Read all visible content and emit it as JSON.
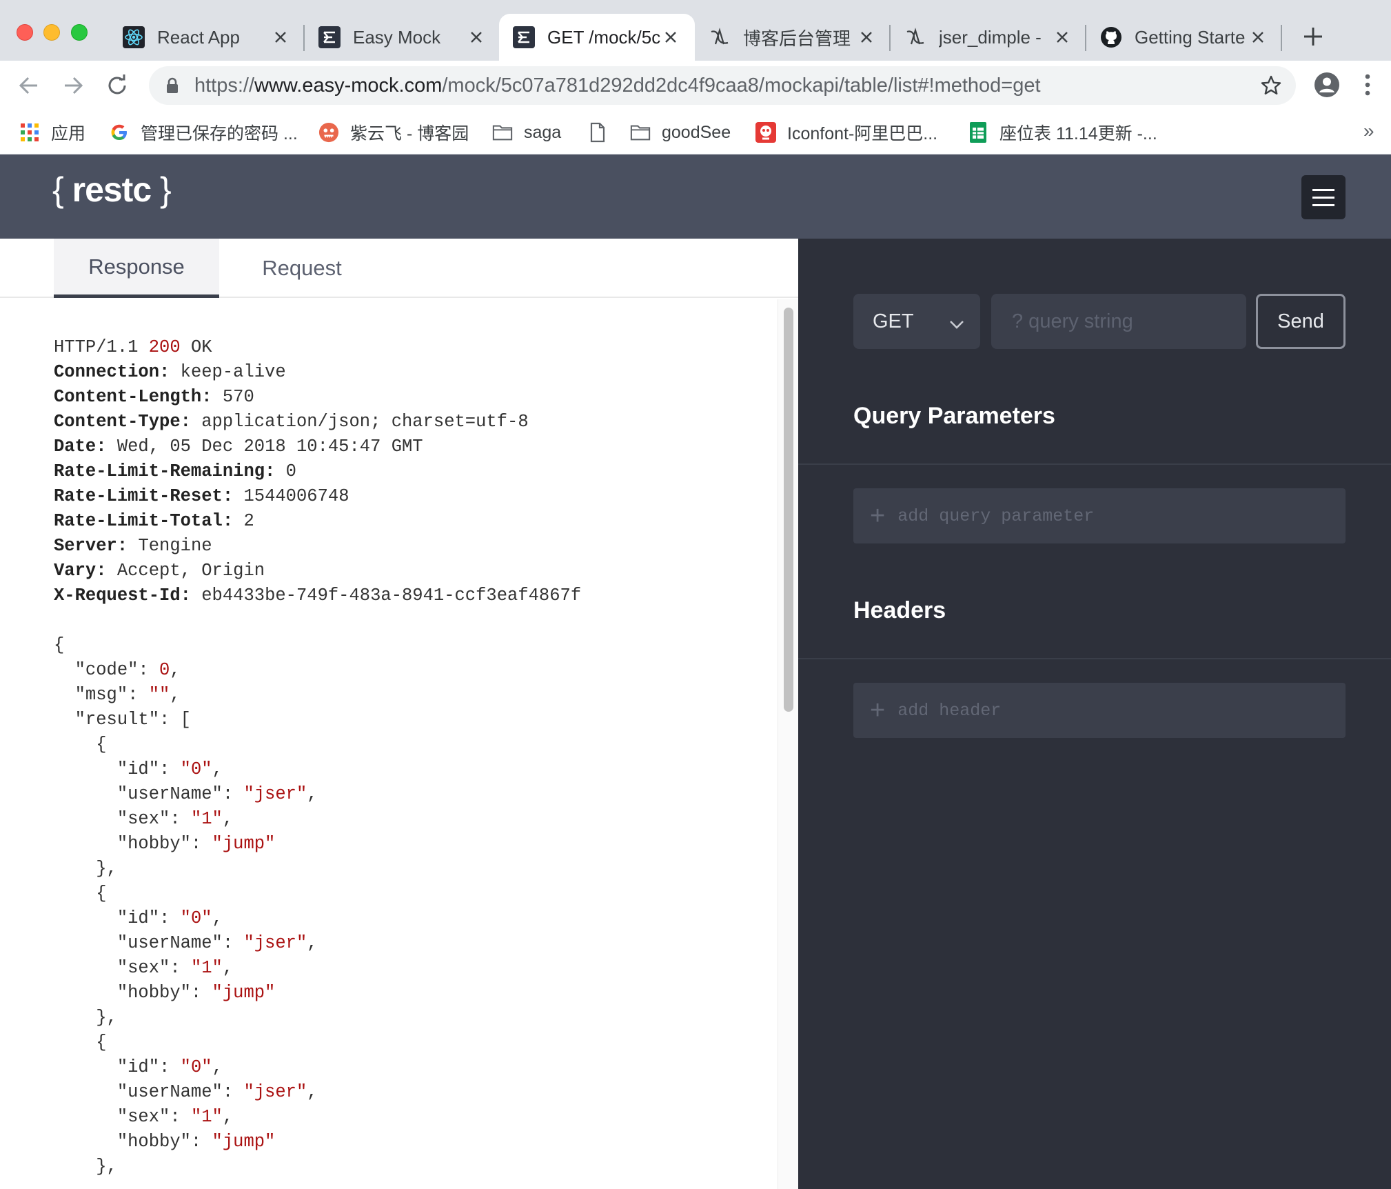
{
  "browser": {
    "tabs": [
      {
        "title": "React App",
        "icon": "react-icon"
      },
      {
        "title": "Easy Mock",
        "icon": "easy-mock-icon"
      },
      {
        "title": "GET /mock/5c",
        "icon": "easy-mock-icon",
        "active": true
      },
      {
        "title": "博客后台管理",
        "icon": "yuque-icon"
      },
      {
        "title": "jser_dimple - ",
        "icon": "yuque-icon"
      },
      {
        "title": "Getting Starte",
        "icon": "github-icon"
      }
    ],
    "url_scheme": "https://",
    "url_host": "www.easy-mock.com",
    "url_path": "/mock/5c07a781d292dd2dc4f9caa8/mockapi/table/list#!method=get",
    "bookmarks": [
      {
        "label": "应用",
        "icon": "apps-grid-icon"
      },
      {
        "label": "管理已保存的密码 ...",
        "icon": "google-icon"
      },
      {
        "label": "紫云飞 - 博客园",
        "icon": "avatar-icon"
      },
      {
        "label": "saga",
        "icon": "folder-icon"
      },
      {
        "label": "",
        "icon": "page-icon"
      },
      {
        "label": "goodSee",
        "icon": "folder-icon"
      },
      {
        "label": "Iconfont-阿里巴巴...",
        "icon": "iconfont-icon"
      },
      {
        "label": "座位表 11.14更新 -...",
        "icon": "sheets-icon"
      }
    ],
    "bookmarks_more": "»"
  },
  "app": {
    "logo_open": "{",
    "logo_word": "restc",
    "logo_close": "}",
    "tabs": {
      "response": "Response",
      "request": "Request"
    }
  },
  "response": {
    "status_proto": "HTTP/1.1",
    "status_code": "200",
    "status_text": "OK",
    "headers": [
      {
        "key": "Connection:",
        "value": "keep-alive"
      },
      {
        "key": "Content-Length:",
        "value": "570"
      },
      {
        "key": "Content-Type:",
        "value": "application/json; charset=utf-8"
      },
      {
        "key": "Date:",
        "value": "Wed, 05 Dec 2018 10:45:47 GMT"
      },
      {
        "key": "Rate-Limit-Remaining:",
        "value": "0"
      },
      {
        "key": "Rate-Limit-Reset:",
        "value": "1544006748"
      },
      {
        "key": "Rate-Limit-Total:",
        "value": "2"
      },
      {
        "key": "Server:",
        "value": "Tengine"
      },
      {
        "key": "Vary:",
        "value": "Accept, Origin"
      },
      {
        "key": "X-Request-Id:",
        "value": "eb4433be-749f-483a-8941-ccf3eaf4867f"
      }
    ],
    "body": {
      "code": "0",
      "msg": "\"\"",
      "result": [
        {
          "id": "\"0\"",
          "userName": "\"jser\"",
          "sex": "\"1\"",
          "hobby": "\"jump\""
        },
        {
          "id": "\"0\"",
          "userName": "\"jser\"",
          "sex": "\"1\"",
          "hobby": "\"jump\""
        },
        {
          "id": "\"0\"",
          "userName": "\"jser\"",
          "sex": "\"1\"",
          "hobby": "\"jump\""
        }
      ]
    }
  },
  "request": {
    "method": "GET",
    "query_placeholder": "? query string",
    "send_label": "Send",
    "query_params_title": "Query Parameters",
    "add_query_param": "add query parameter",
    "headers_title": "Headers",
    "add_header": "add header"
  }
}
